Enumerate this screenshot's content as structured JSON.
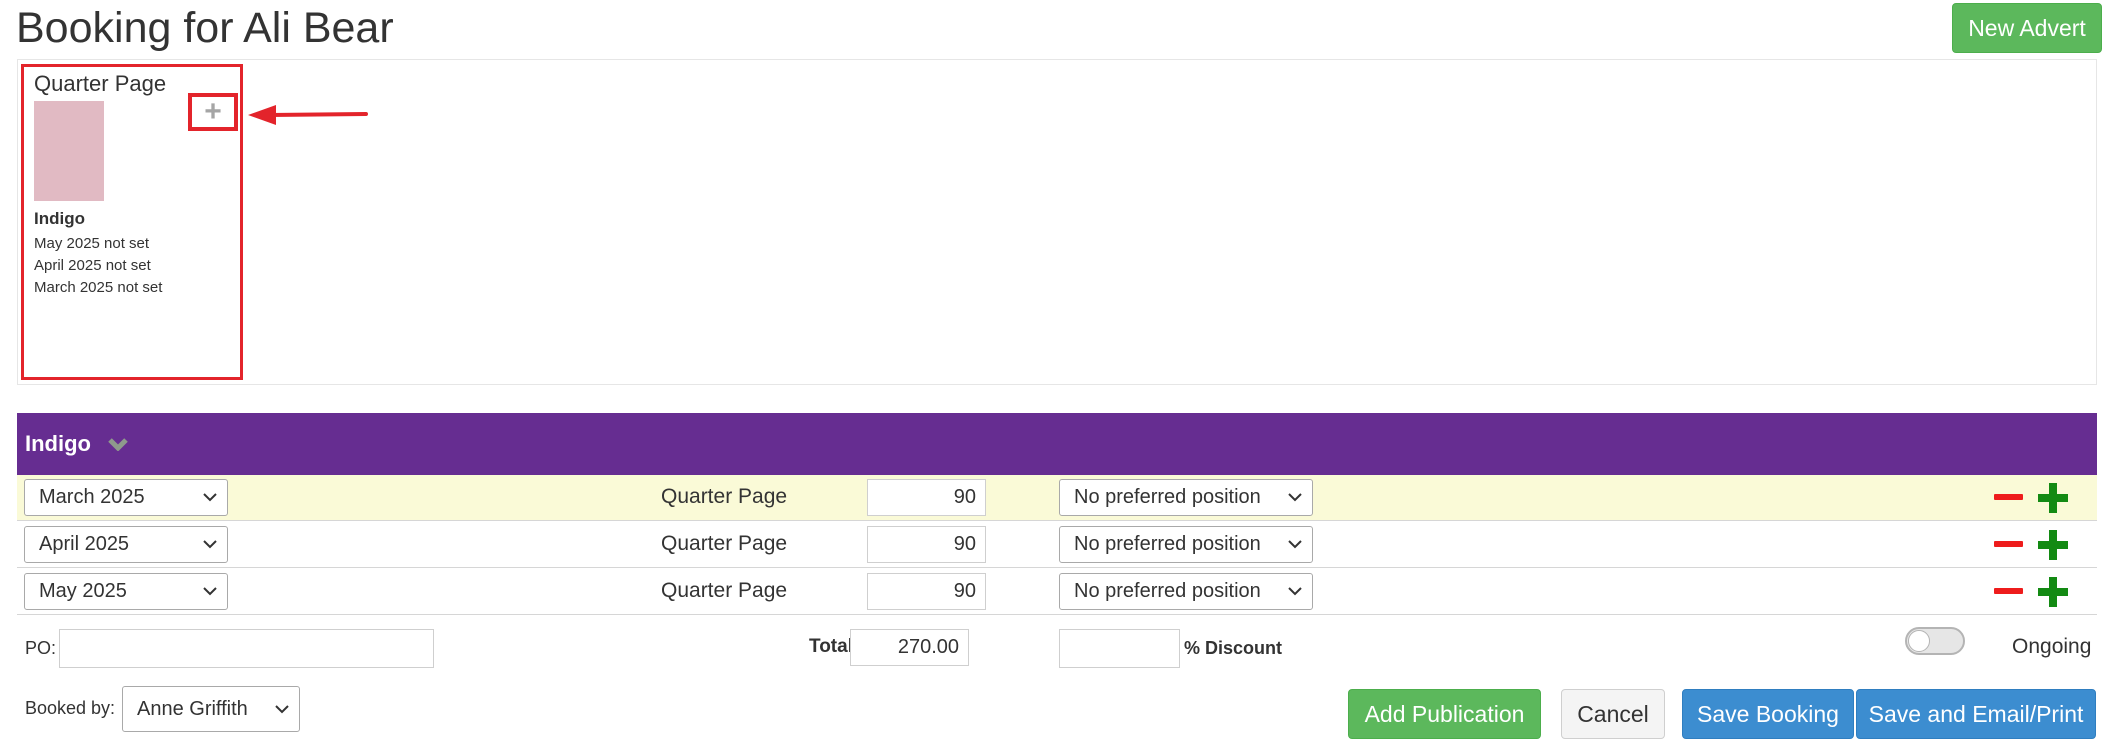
{
  "page": {
    "title": "Booking for Ali Bear"
  },
  "header": {
    "new_advert_label": "New Advert"
  },
  "advert_card": {
    "title": "Quarter Page",
    "add_symbol": "+",
    "publication": "Indigo",
    "dates": [
      "May 2025 not set",
      "April 2025 not set",
      "March 2025 not set"
    ],
    "thumb_color": "#e1bac3"
  },
  "publication": {
    "name": "Indigo",
    "header_color": "#662d91"
  },
  "bookings": [
    {
      "month": "March 2025",
      "size": "Quarter Page",
      "price": "90",
      "position": "No preferred position"
    },
    {
      "month": "April 2025",
      "size": "Quarter Page",
      "price": "90",
      "position": "No preferred position"
    },
    {
      "month": "May 2025",
      "size": "Quarter Page",
      "price": "90",
      "position": "No preferred position"
    }
  ],
  "summary": {
    "po_label": "PO:",
    "po_value": "",
    "total_label": "Total",
    "total_value": "270.00",
    "discount_value": "",
    "discount_label": "% Discount",
    "ongoing_label": "Ongoing",
    "ongoing_enabled": false
  },
  "footer": {
    "booked_by_label": "Booked by:",
    "booked_by_value": "Anne Griffith",
    "add_publication_label": "Add Publication",
    "cancel_label": "Cancel",
    "save_booking_label": "Save Booking",
    "save_email_label": "Save and Email/Print"
  },
  "icons": {
    "card_add": "plus-icon",
    "annotation": "arrow-left-icon",
    "header_toggle": "chevron-down-icon",
    "remove_row": "minus-icon",
    "add_row": "plus-icon"
  },
  "colors": {
    "green": "#5cb85c",
    "blue": "#3c8dd0",
    "purple": "#662d91",
    "red": "#ee1c1c",
    "dark_green": "#138a13",
    "row_highlight": "#fafad7"
  }
}
